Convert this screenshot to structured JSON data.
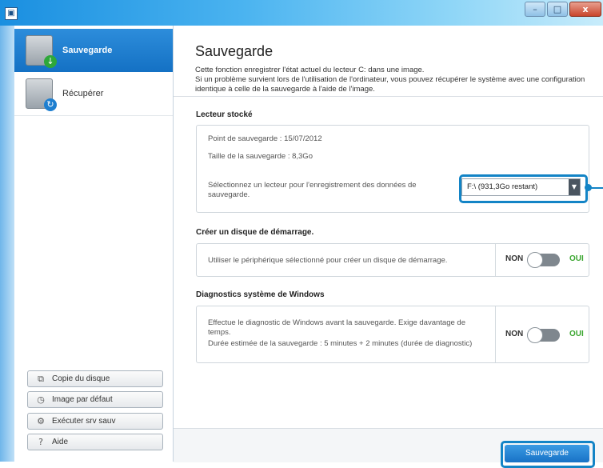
{
  "window": {
    "minimize": "–",
    "maximize": "□",
    "close": "x"
  },
  "sidebar": {
    "items": [
      {
        "label": "Sauvegarde",
        "icon": "backup-drive-icon"
      },
      {
        "label": "Récupérer",
        "icon": "restore-drive-icon"
      }
    ],
    "buttons": [
      {
        "label": "Copie du disque",
        "icon": "copy-icon"
      },
      {
        "label": "Image par défaut",
        "icon": "default-image-icon"
      },
      {
        "label": "Exécuter srv sauv",
        "icon": "run-service-icon"
      },
      {
        "label": "Aide",
        "icon": "help-icon"
      }
    ]
  },
  "header": {
    "title": "Sauvegarde",
    "description_line1": "Cette fonction enregistrer l'état actuel du lecteur C: dans une image.",
    "description_line2": "Si un problème survient lors de l'utilisation de l'ordinateur, vous pouvez récupérer le système avec une configuration identique à celle de la sauvegarde à l'aide de l'image."
  },
  "storage": {
    "section_title": "Lecteur stocké",
    "backup_point": "Point de sauvegarde : 15/07/2012",
    "backup_size": "Taille de la sauvegarde : 8,3Go",
    "select_prompt": "Sélectionnez un lecteur pour l'enregistrement des données de sauvegarde.",
    "selected_drive": "F:\\ (931,3Go restant)"
  },
  "boot_disk": {
    "section_title": "Créer un disque de démarrage.",
    "text": "Utiliser le périphérique sélectionné pour créer un disque de démarrage.",
    "off_label": "NON",
    "on_label": "OUI",
    "enabled": false
  },
  "diagnostics": {
    "section_title": "Diagnostics système de Windows",
    "text_line1": "Effectue le diagnostic de Windows avant la sauvegarde. Exige davantage de temps.",
    "text_line2": "Durée estimée de la sauvegarde : 5 minutes + 2 minutes (durée de diagnostic)",
    "off_label": "NON",
    "on_label": "OUI",
    "enabled": false
  },
  "footer": {
    "save_label": "Sauvegarde"
  },
  "colors": {
    "accent": "#1471c4",
    "highlight": "#1384c6",
    "on_green": "#3aa62f"
  }
}
